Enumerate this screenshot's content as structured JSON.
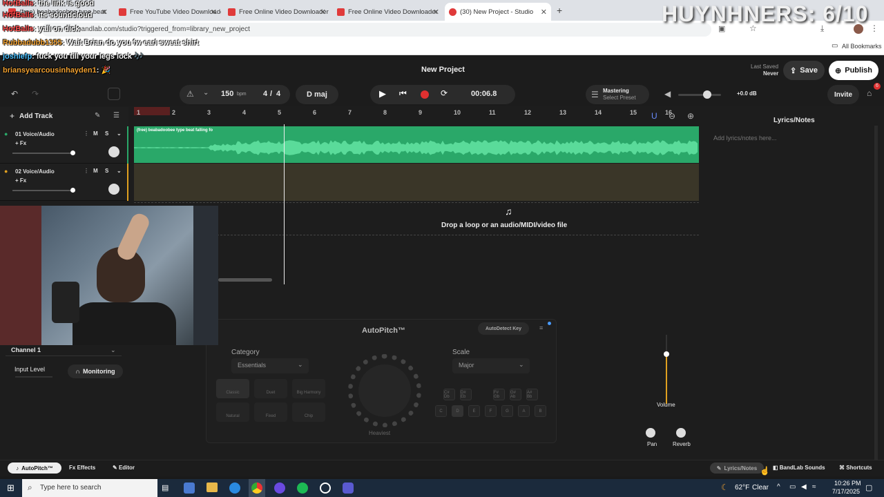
{
  "browser": {
    "tabs": [
      {
        "label": "(free) beabadoobee type beat",
        "active": false
      },
      {
        "label": "Free YouTube Video Downloade",
        "active": false
      },
      {
        "label": "Free Online Video Downloader",
        "active": false
      },
      {
        "label": "Free Online Video Downloader",
        "active": false
      },
      {
        "label": "(30) New Project - Studio",
        "active": true
      }
    ],
    "url": "bandlab.com/studio?triggered_from=library_new_project",
    "all_bookmarks": "All Bookmarks"
  },
  "overlay": {
    "title": "HUYNHNERS: 6/10",
    "chat": [
      {
        "user": "HotBalls",
        "msg": ": the link is good"
      },
      {
        "user": "HotBalls",
        "msg": ": its soundcloud"
      },
      {
        "user": "HotBalls",
        "msg": ": yall on dick"
      },
      {
        "user": "Rubbadubb1355",
        "msg": ": Wait Brian do you fw earl sweat shirt"
      },
      {
        "user": "joshiefp",
        "msg": ": fuck you till your legs lock 🎶"
      },
      {
        "user": "briansyearcousinhayden1",
        "msg": ": 🎉"
      }
    ]
  },
  "header": {
    "project_title": "New Project",
    "last_saved_label": "Last Saved",
    "last_saved_value": "Never",
    "save_label": "Save",
    "publish_label": "Publish"
  },
  "transport": {
    "tempo": "150",
    "tempo_unit": "bpm",
    "time_sig_top": "4",
    "time_sig_bottom": "4",
    "key": "D maj",
    "time": "00:06.8",
    "mastering_label": "Mastering",
    "mastering_preset": "Select Preset",
    "master_volume": "+0.0 dB",
    "invite_label": "Invite",
    "notif_count": "6"
  },
  "tracks_header": {
    "add_track_label": "Add Track"
  },
  "tracks": [
    {
      "name": "01  Voice/Audio",
      "fx": "+ Fx",
      "mute": "M",
      "solo": "S",
      "clip_label": "(free) beabadoobee type beat  falling fo",
      "color": "#2aa869"
    },
    {
      "name": "02  Voice/Audio",
      "fx": "+ Fx",
      "mute": "M",
      "solo": "S",
      "clip_label": "",
      "color": "#e0a020"
    }
  ],
  "ruler": [
    "1",
    "2",
    "3",
    "4",
    "5",
    "6",
    "7",
    "8",
    "9",
    "10",
    "11",
    "12",
    "13",
    "14",
    "15",
    "16"
  ],
  "drop_area": {
    "text": "Drop a loop or an audio/MIDI/video file"
  },
  "lyrics": {
    "title": "Lyrics/Notes",
    "placeholder": "Add lyrics/notes here..."
  },
  "input_panel": {
    "channel": "Channel 1",
    "input_level": "Input Level",
    "monitoring": "Monitoring"
  },
  "autopitch": {
    "title": "AutoPitch™",
    "autodetect": "AutoDetect Key",
    "category_label": "Category",
    "category_value": "Essentials",
    "scale_label": "Scale",
    "scale_value": "Major",
    "presets": [
      "Classic",
      "Duet",
      "Big Harmony",
      "Natural",
      "Fixed",
      "Chip"
    ],
    "knob_label": "Heaviest",
    "keys_top": [
      "C#\nDb",
      "D#\nEb",
      "F#\nGb",
      "G#\nAb",
      "A#\nBb"
    ],
    "keys_bottom": [
      "C",
      "D",
      "E",
      "F",
      "G",
      "A",
      "B"
    ]
  },
  "mixer": {
    "volume_label": "Volume",
    "pan_label": "Pan",
    "reverb_label": "Reverb"
  },
  "bottom_bar": {
    "autopitch": "AutoPitch™",
    "effects": "Effects",
    "editor": "Editor",
    "lyrics_notes": "Lyrics/Notes",
    "bandlab_sounds": "BandLab Sounds",
    "shortcuts": "Shortcuts"
  },
  "taskbar": {
    "search_placeholder": "Type here to search",
    "weather": "62°F",
    "weather_desc": "Clear",
    "time": "10:26 PM",
    "date": "7/17/2025"
  },
  "colors": {
    "accent_green": "#2aa869",
    "accent_yellow": "#e0a020",
    "record_red": "#e03030"
  }
}
